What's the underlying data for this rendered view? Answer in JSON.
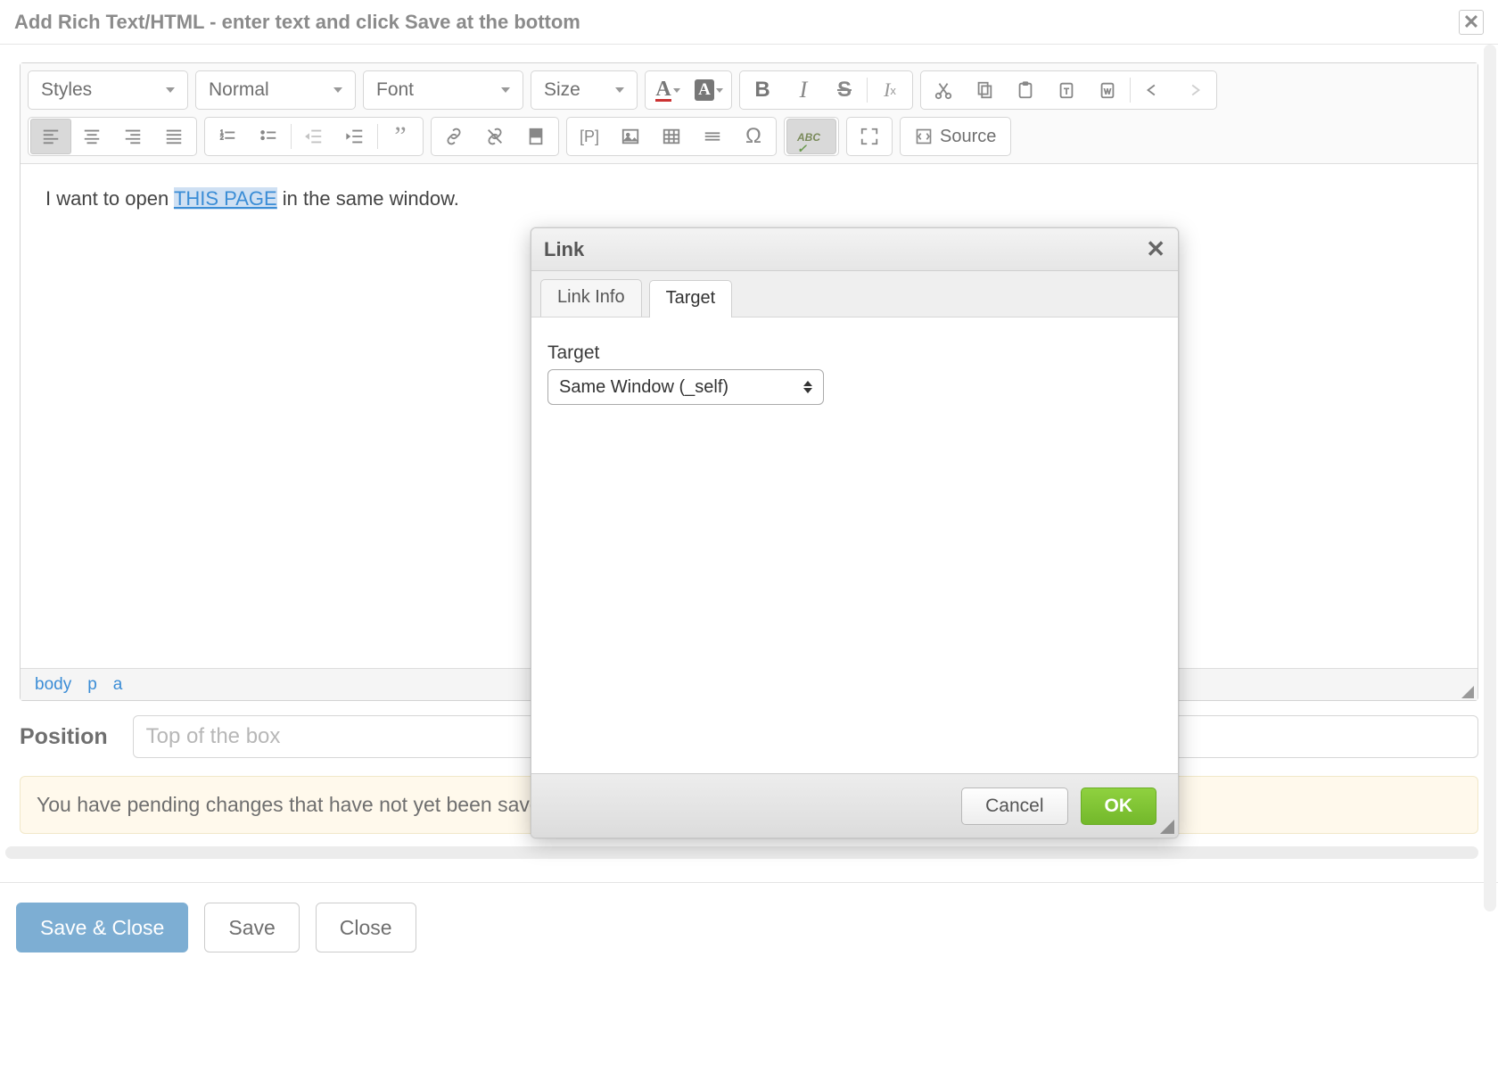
{
  "window": {
    "title": "Add Rich Text/HTML - enter text and click Save at the bottom"
  },
  "toolbar": {
    "combos": {
      "styles": "Styles",
      "format": "Normal",
      "font": "Font",
      "size": "Size"
    },
    "source_label": "Source",
    "spell_label": "ABC"
  },
  "content": {
    "pre": "I want to open ",
    "link": "THIS PAGE",
    "post": " in the same window."
  },
  "pathbar": [
    "body",
    "p",
    "a"
  ],
  "position": {
    "label": "Position",
    "value": "Top of the box"
  },
  "warning": "You have pending changes that have not yet been saved.",
  "footer": {
    "save_close": "Save & Close",
    "save": "Save",
    "close": "Close"
  },
  "dialog": {
    "title": "Link",
    "tabs": {
      "info": "Link Info",
      "target": "Target"
    },
    "target_label": "Target",
    "target_value": "Same Window (_self)",
    "cancel": "Cancel",
    "ok": "OK"
  }
}
